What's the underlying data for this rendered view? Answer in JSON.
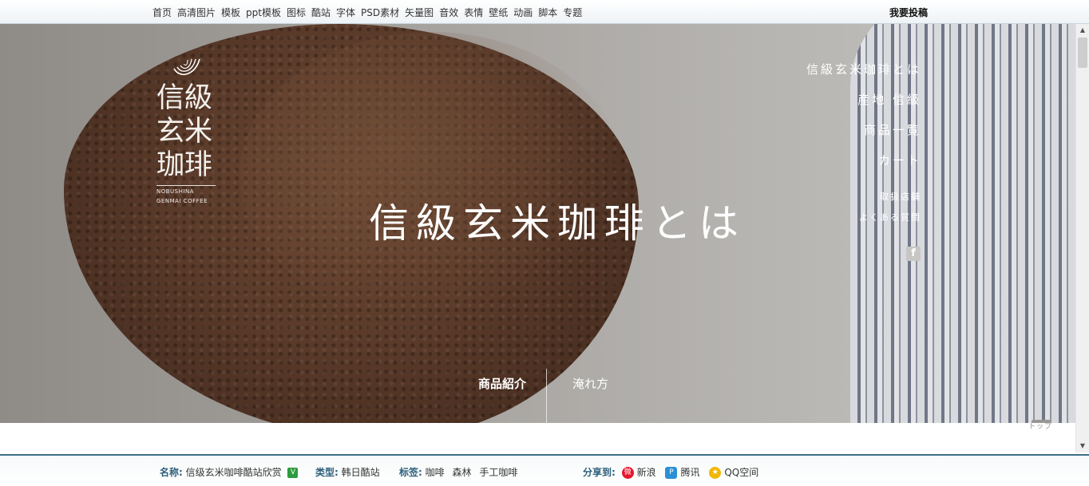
{
  "topnav": {
    "items": [
      "首页",
      "高清图片",
      "模板",
      "ppt模板",
      "图标",
      "酷站",
      "字体",
      "PSD素材",
      "矢量图",
      "音效",
      "表情",
      "壁纸",
      "动画",
      "脚本",
      "专题"
    ],
    "submit_label": "我要投稿"
  },
  "hero": {
    "logo_kanji": [
      "信級",
      "玄米",
      "珈琲"
    ],
    "logo_en": [
      "NOBUSHINA",
      "GENMAI COFFEE"
    ],
    "title": "信級玄米珈琲とは",
    "menu_main": [
      "信級玄米珈琲とは",
      "産地 信級",
      "商品一覧",
      "カート"
    ],
    "menu_sub": [
      "取扱店舗",
      "よくある質問"
    ],
    "facebook_icon": "facebook-icon",
    "tabs": [
      "商品紹介",
      "淹れ方"
    ],
    "to_top_label": "トップ"
  },
  "footer": {
    "name_label": "名称:",
    "name_value": "信级玄米咖啡酷站欣赏",
    "verified_icon": "V",
    "type_label": "类型:",
    "type_value": "韩日酷站",
    "tags_label": "标签:",
    "tags": [
      "咖啡",
      "森林",
      "手工咖啡"
    ],
    "share_label": "分享到:",
    "share": [
      "新浪",
      "腾讯",
      "QQ空间"
    ]
  },
  "colors": {
    "footer_accent": "#3d6f85",
    "footer_key": "#2c5f7a",
    "verified": "#2e9b3e"
  }
}
